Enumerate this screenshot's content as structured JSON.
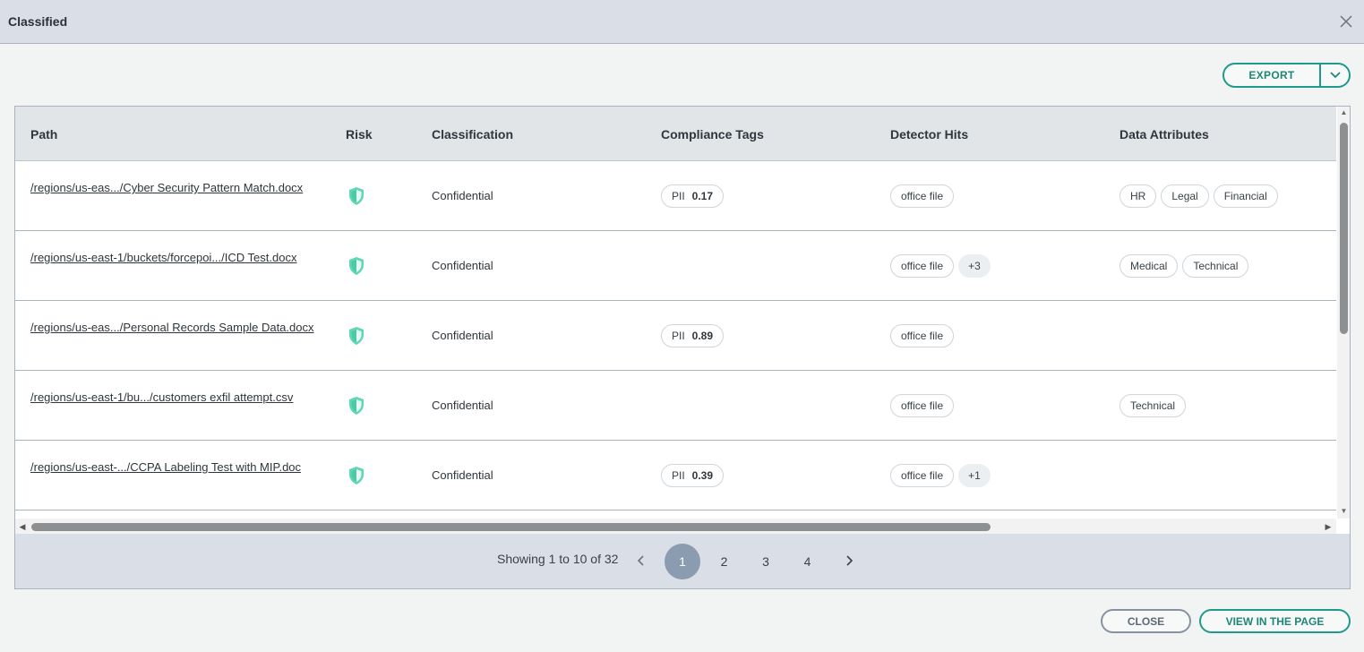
{
  "dialog": {
    "title": "Classified",
    "close_icon": "close-icon"
  },
  "toolbar": {
    "export_label": "EXPORT",
    "export_dropdown_icon": "chevron-down-icon",
    "accent": "#1f9a8a"
  },
  "table": {
    "columns": [
      "Path",
      "Risk",
      "Classification",
      "Compliance Tags",
      "Detector Hits",
      "Data Attributes"
    ],
    "rows": [
      {
        "path": "/regions/us-eas.../Cyber Security Pattern Match.docx",
        "risk_icon": "shield-icon",
        "classification": "Confidential",
        "compliance": {
          "label": "PII",
          "score": "0.17"
        },
        "detector": "office file",
        "detector_more": "",
        "attributes": [
          "HR",
          "Legal",
          "Financial"
        ]
      },
      {
        "path": "/regions/us-east-1/buckets/forcepoi.../ICD Test.docx",
        "risk_icon": "shield-icon",
        "classification": "Confidential",
        "compliance": null,
        "detector": "office file",
        "detector_more": "+3",
        "attributes": [
          "Medical",
          "Technical"
        ]
      },
      {
        "path": "/regions/us-eas.../Personal Records Sample Data.docx",
        "risk_icon": "shield-icon",
        "classification": "Confidential",
        "compliance": {
          "label": "PII",
          "score": "0.89"
        },
        "detector": "office file",
        "detector_more": "",
        "attributes": []
      },
      {
        "path": "/regions/us-east-1/bu.../customers exfil attempt.csv",
        "risk_icon": "shield-icon",
        "classification": "Confidential",
        "compliance": null,
        "detector": "office file",
        "detector_more": "",
        "attributes": [
          "Technical"
        ]
      },
      {
        "path": "/regions/us-east-.../CCPA Labeling Test with MIP.doc",
        "risk_icon": "shield-icon",
        "classification": "Confidential",
        "compliance": {
          "label": "PII",
          "score": "0.39"
        },
        "detector": "office file",
        "detector_more": "+1",
        "attributes": []
      }
    ]
  },
  "pagination": {
    "summary": "Showing 1 to 10 of 32",
    "pages": [
      "1",
      "2",
      "3",
      "4"
    ],
    "current": "1",
    "prev_icon": "chevron-left-icon",
    "next_icon": "chevron-right-icon"
  },
  "footer": {
    "close_label": "CLOSE",
    "view_label": "VIEW IN THE PAGE"
  }
}
